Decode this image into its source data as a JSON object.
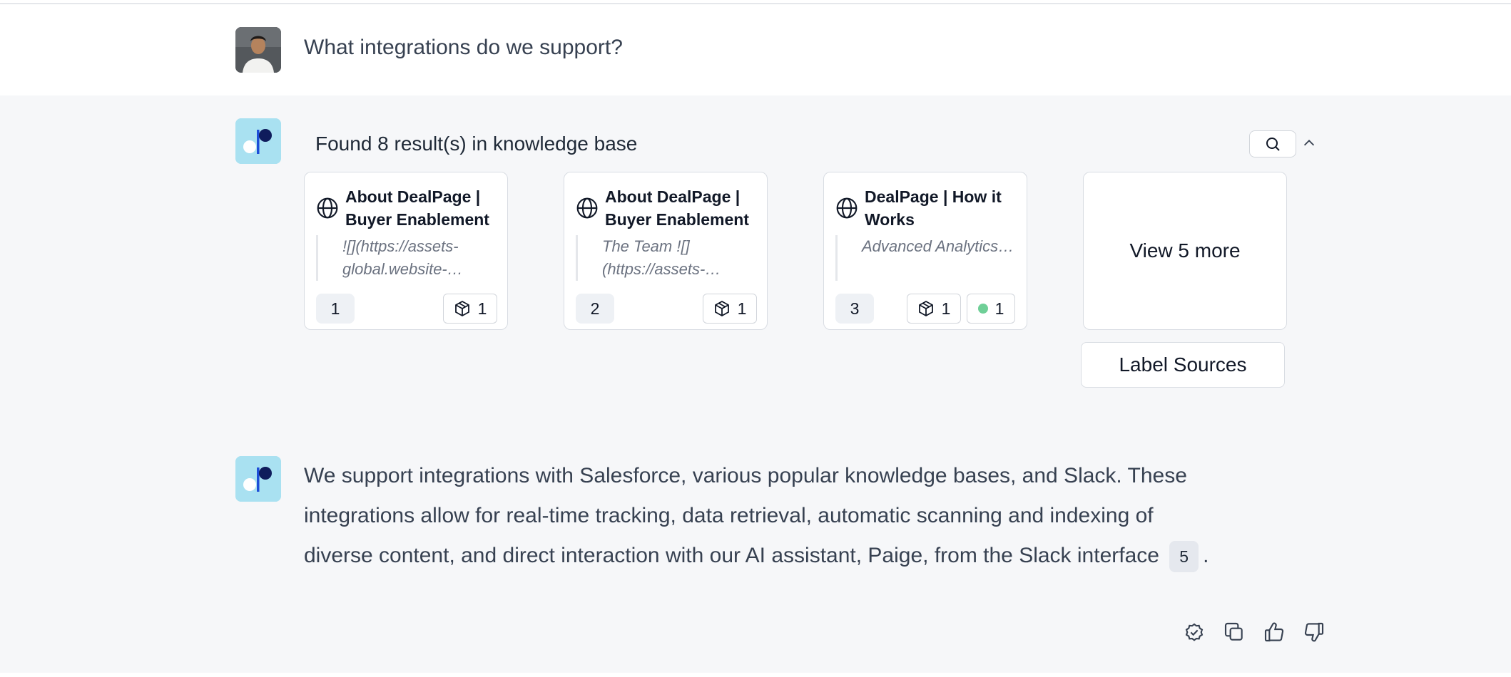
{
  "user_message": {
    "text": "What integrations do we support?"
  },
  "sources_panel": {
    "title": "Found 8 result(s) in knowledge base",
    "cards": [
      {
        "number": "1",
        "title": "About DealPage | Buyer Enablement",
        "excerpt": "![](https://assets-global.website-…",
        "object_count": "1"
      },
      {
        "number": "2",
        "title": "About DealPage | Buyer Enablement",
        "excerpt": "The Team ![](https://assets-…",
        "object_count": "1"
      },
      {
        "number": "3",
        "title": "DealPage | How it Works",
        "excerpt": "Advanced Analytics…",
        "object_count": "1",
        "status_count": "1"
      }
    ],
    "view_more_label": "View 5 more",
    "label_sources_button": "Label Sources"
  },
  "answer": {
    "text": "We support integrations with Salesforce, various popular knowledge bases, and Slack. These integrations allow for real-time tracking, data retrieval, automatic scanning and indexing of diverse content, and direct interaction with our AI assistant, Paige, from the Slack interface",
    "citation": "5",
    "trailing": "."
  },
  "icons": {
    "search": "search-icon",
    "collapse": "chevron-up-icon",
    "source": "globe-icon",
    "object": "cube-icon",
    "status": "green-dot",
    "verify": "check-badge-icon",
    "copy": "copy-icon",
    "like": "thumbs-up-icon",
    "dislike": "thumbs-down-icon"
  },
  "colors": {
    "bot_avatar_bg": "#a9e1f1",
    "bot_avatar_accent": "#0f1c5c",
    "status_dot": "#6fcf97",
    "panel_bg": "#f6f7f9"
  }
}
